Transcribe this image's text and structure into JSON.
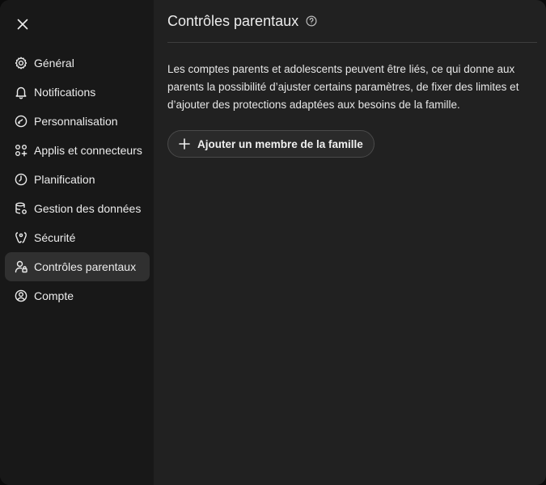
{
  "sidebar": {
    "close_icon": "close-icon",
    "items": [
      {
        "label": "Général",
        "icon": "gear-icon",
        "active": false
      },
      {
        "label": "Notifications",
        "icon": "bell-icon",
        "active": false
      },
      {
        "label": "Personnalisation",
        "icon": "personalization-icon",
        "active": false
      },
      {
        "label": "Applis et connecteurs",
        "icon": "apps-grid-icon",
        "active": false
      },
      {
        "label": "Planification",
        "icon": "clock-icon",
        "active": false
      },
      {
        "label": "Gestion des données",
        "icon": "database-icon",
        "active": false
      },
      {
        "label": "Sécurité",
        "icon": "shield-icon",
        "active": false
      },
      {
        "label": "Contrôles parentaux",
        "icon": "parent-user-lock-icon",
        "active": true
      },
      {
        "label": "Compte",
        "icon": "user-circle-icon",
        "active": false
      }
    ]
  },
  "main": {
    "title": "Contrôles parentaux",
    "help_icon": "help-circle-icon",
    "description": "Les comptes parents et adolescents peuvent être liés, ce qui donne aux parents la possibilité d’ajuster certains paramètres, de fixer des limites et d’ajouter des protections adaptées aux besoins de la famille.",
    "add_button_label": "Ajouter un membre de la famille",
    "add_button_icon": "plus-icon"
  },
  "colors": {
    "dialog_bg": "#212121",
    "sidebar_bg": "#181818",
    "active_item_bg": "#303030",
    "text": "#ececec"
  }
}
